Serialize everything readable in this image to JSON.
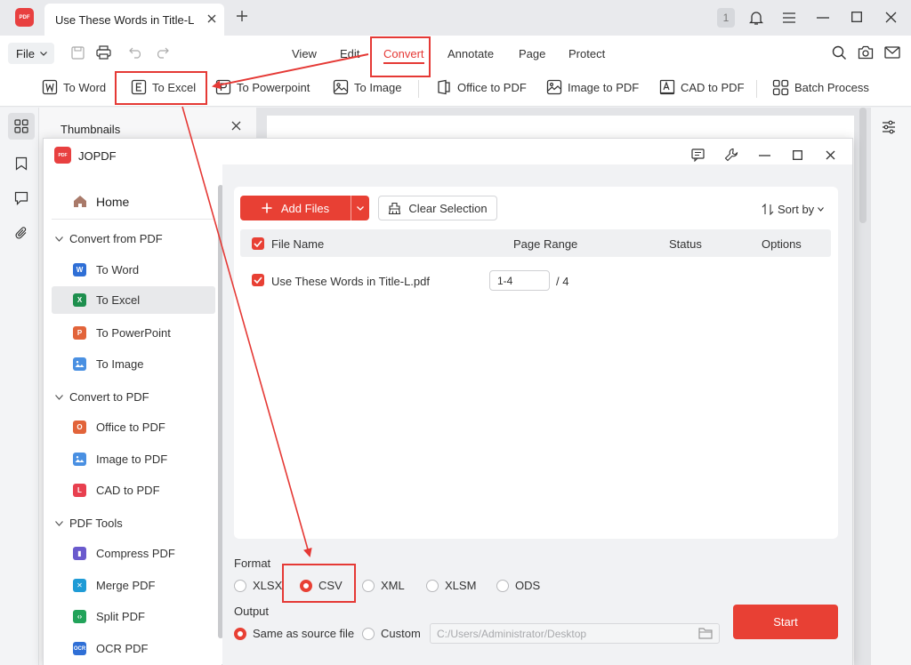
{
  "app": {
    "tab_title": "Use These Words in Title-L",
    "notification_count": "1",
    "logo_text": "PDF"
  },
  "menu": {
    "file_label": "File",
    "items": [
      "View",
      "Edit",
      "Convert",
      "Annotate",
      "Page",
      "Protect"
    ],
    "active": "Convert"
  },
  "toolbar": {
    "items": [
      "To Word",
      "To Excel",
      "To Powerpoint",
      "To Image",
      "Office to PDF",
      "Image to PDF",
      "CAD to PDF",
      "Batch Process"
    ],
    "highlighted": "To Excel"
  },
  "thumbnails": {
    "title": "Thumbnails"
  },
  "dialog": {
    "title": "JOPDF",
    "sidebar": {
      "home": "Home",
      "groups": [
        {
          "label": "Convert from PDF",
          "items": [
            "To Word",
            "To Excel",
            "To PowerPoint",
            "To Image"
          ]
        },
        {
          "label": "Convert to PDF",
          "items": [
            "Office to PDF",
            "Image to PDF",
            "CAD to PDF"
          ]
        },
        {
          "label": "PDF Tools",
          "items": [
            "Compress PDF",
            "Merge PDF",
            "Split PDF",
            "OCR PDF"
          ]
        }
      ],
      "selected": "To Excel"
    },
    "actions": {
      "add_files": "Add Files",
      "clear_selection": "Clear Selection",
      "sort_by": "Sort by"
    },
    "table": {
      "columns": [
        "File Name",
        "Page Range",
        "Status",
        "Options"
      ],
      "rows": [
        {
          "file_name": "Use These Words in Title-L.pdf",
          "page_range": "1-4",
          "total_pages": "/ 4",
          "checked": true
        }
      ]
    },
    "format": {
      "label": "Format",
      "options": [
        "XLSX",
        "CSV",
        "XML",
        "XLSM",
        "ODS"
      ],
      "selected": "CSV"
    },
    "output": {
      "label": "Output",
      "options": [
        "Same as source file",
        "Custom"
      ],
      "selected": "Same as source file",
      "path": "C:/Users/Administrator/Desktop"
    },
    "start_label": "Start"
  },
  "colors": {
    "accent": "#e84034",
    "annotation": "#e53935",
    "word": "#2f6fd6",
    "excel": "#1e8f4e",
    "powerpoint": "#e2643a",
    "image": "#4a90e2"
  }
}
